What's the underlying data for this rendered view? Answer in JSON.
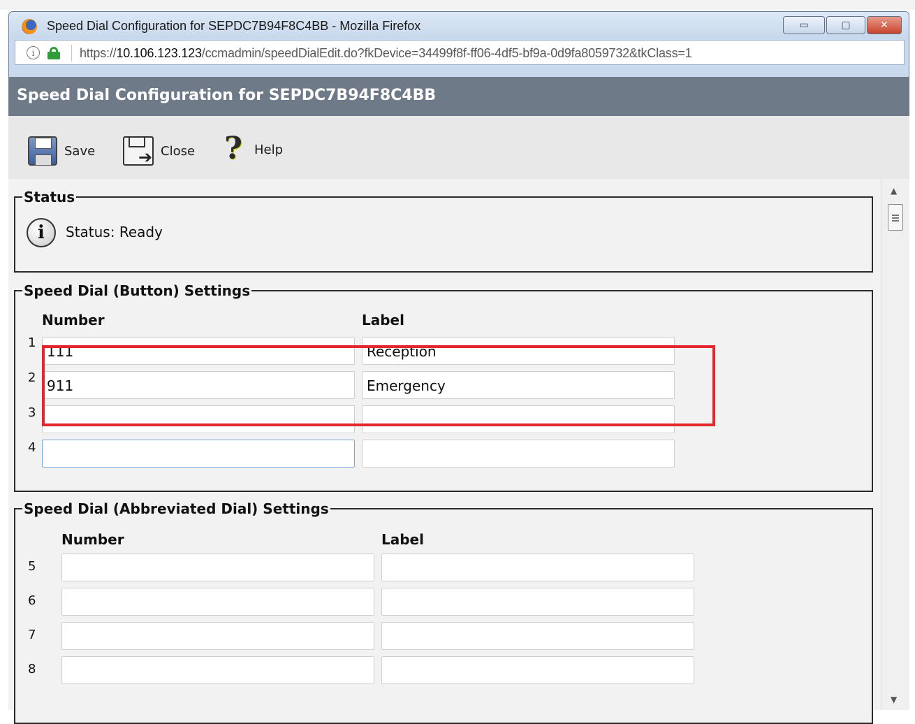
{
  "window": {
    "title": "Speed Dial Configuration for SEPDC7B94F8C4BB - Mozilla Firefox",
    "url_scheme": "https://",
    "url_host": "10.106.123.123",
    "url_path": "/ccmadmin/speedDialEdit.do?fkDevice=34499f8f-ff06-4df5-bf9a-0d9fa8059732&tkClass=1",
    "minimize_glyph": "▭",
    "maximize_glyph": "▢",
    "close_glyph": "✕"
  },
  "page": {
    "title": "Speed Dial Configuration for SEPDC7B94F8C4BB"
  },
  "toolbar": {
    "save_label": "Save",
    "close_label": "Close",
    "help_label": "Help"
  },
  "status": {
    "legend": "Status",
    "text": "Status: Ready"
  },
  "button_settings": {
    "legend": "Speed Dial (Button) Settings",
    "number_header": "Number",
    "label_header": "Label",
    "rows": [
      {
        "index": "1",
        "number": "111",
        "label": "Reception"
      },
      {
        "index": "2",
        "number": "911",
        "label": "Emergency"
      },
      {
        "index": "3",
        "number": "",
        "label": ""
      },
      {
        "index": "4",
        "number": "",
        "label": ""
      }
    ]
  },
  "abbreviated_settings": {
    "legend": "Speed Dial (Abbreviated Dial) Settings",
    "number_header": "Number",
    "label_header": "Label",
    "rows": [
      {
        "index": "5",
        "number": "",
        "label": ""
      },
      {
        "index": "6",
        "number": "",
        "label": ""
      },
      {
        "index": "7",
        "number": "",
        "label": ""
      },
      {
        "index": "8",
        "number": "",
        "label": ""
      }
    ]
  },
  "icons": {
    "browser": "firefox-logo-icon",
    "site_info": "info-icon",
    "secure": "lock-icon",
    "save": "floppy-disk-icon",
    "close": "close-document-icon",
    "help": "question-mark-icon",
    "status": "info-circle-icon"
  },
  "colors": {
    "header_bar": "#6f7a88",
    "highlight_box": "#e3262f",
    "lock_green": "#2f9b3a"
  }
}
